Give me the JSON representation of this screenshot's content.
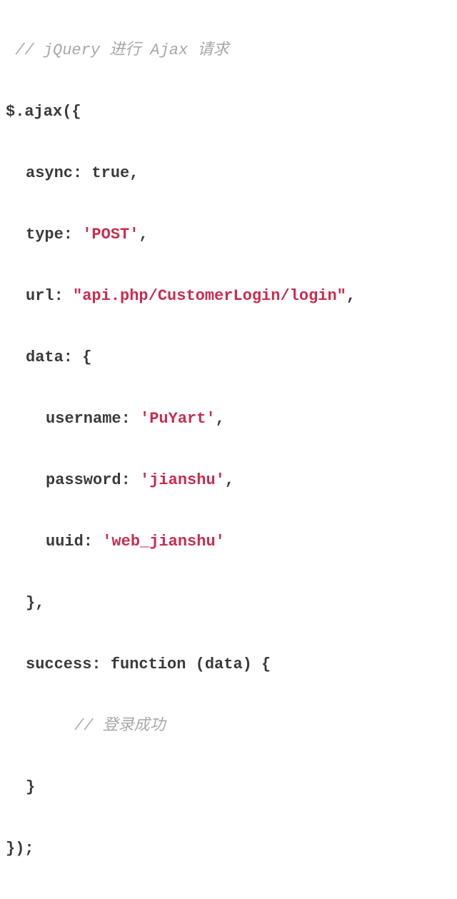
{
  "code": {
    "l1": {
      "comment": "// jQuery 进行 Ajax 请求"
    },
    "l2": "$.ajax({",
    "l3": {
      "key": "async:",
      "val": "true",
      "end": ","
    },
    "l4": {
      "key": "type:",
      "val": "'POST'",
      "end": ","
    },
    "l5": {
      "key": "url:",
      "val": "\"api.php/CustomerLogin/login\"",
      "end": ","
    },
    "l6": "data: {",
    "l7": {
      "key": "username:",
      "val": "'PuYart'",
      "end": ","
    },
    "l8": {
      "key": "password:",
      "val": "'jianshu'",
      "end": ","
    },
    "l9": {
      "key": "uuid:",
      "val": "'web_jianshu'"
    },
    "l10": "},",
    "l11": "success: function (data) {",
    "l12": {
      "comment": "// 登录成功"
    },
    "l13": "}",
    "l14": "});"
  }
}
